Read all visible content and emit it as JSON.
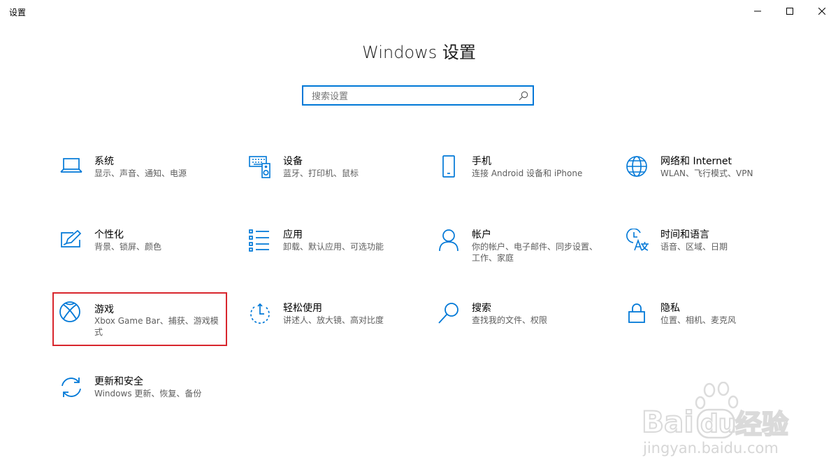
{
  "window": {
    "app_title": "设置",
    "heading": "Windows 设置"
  },
  "search": {
    "placeholder": "搜索设置",
    "value": ""
  },
  "accent_color": "#0078d7",
  "highlight_color": "#d8262d",
  "categories": [
    {
      "title": "系统",
      "desc": "显示、声音、通知、电源",
      "icon": "laptop-icon"
    },
    {
      "title": "设备",
      "desc": "蓝牙、打印机、鼠标",
      "icon": "keyboard-speaker-icon"
    },
    {
      "title": "手机",
      "desc": "连接 Android 设备和 iPhone",
      "icon": "phone-icon"
    },
    {
      "title": "网络和 Internet",
      "desc": "WLAN、飞行模式、VPN",
      "icon": "globe-icon"
    },
    {
      "title": "个性化",
      "desc": "背景、锁屏、颜色",
      "icon": "paint-icon"
    },
    {
      "title": "应用",
      "desc": "卸载、默认应用、可选功能",
      "icon": "apps-list-icon"
    },
    {
      "title": "帐户",
      "desc": "你的帐户、电子邮件、同步设置、工作、家庭",
      "icon": "person-icon"
    },
    {
      "title": "时间和语言",
      "desc": "语音、区域、日期",
      "icon": "time-language-icon"
    },
    {
      "title": "游戏",
      "desc": "Xbox Game Bar、捕获、游戏模式",
      "icon": "xbox-icon",
      "highlighted": true
    },
    {
      "title": "轻松使用",
      "desc": "讲述人、放大镜、高对比度",
      "icon": "ease-of-access-icon"
    },
    {
      "title": "搜索",
      "desc": "查找我的文件、权限",
      "icon": "search-icon"
    },
    {
      "title": "隐私",
      "desc": "位置、相机、麦克风",
      "icon": "lock-icon"
    },
    {
      "title": "更新和安全",
      "desc": "Windows 更新、恢复、备份",
      "icon": "sync-icon"
    }
  ],
  "watermark": {
    "brand": "Bai du 经验",
    "url": "jingyan.baidu.com"
  }
}
